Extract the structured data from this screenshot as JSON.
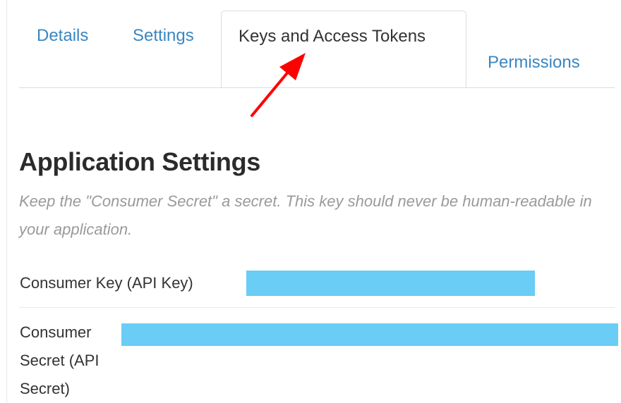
{
  "tabs": {
    "details": "Details",
    "settings": "Settings",
    "keys_and_tokens": "Keys and Access Tokens",
    "permissions": "Permissions",
    "active": "keys_and_tokens"
  },
  "annotation": {
    "type": "arrow",
    "color": "#ff0000",
    "points_to": "keys_and_tokens"
  },
  "section": {
    "title": "Application Settings",
    "description": "Keep the \"Consumer Secret\" a secret. This key should never be human-readable in your application."
  },
  "fields": {
    "consumer_key": {
      "label": "Consumer Key (API Key)",
      "value_redacted": true
    },
    "consumer_secret": {
      "label": "Consumer Secret (API Secret)",
      "value_redacted": true
    }
  },
  "colors": {
    "link": "#3a87c1",
    "redaction": "#69cdf5",
    "muted_text": "#9a9a9a"
  }
}
